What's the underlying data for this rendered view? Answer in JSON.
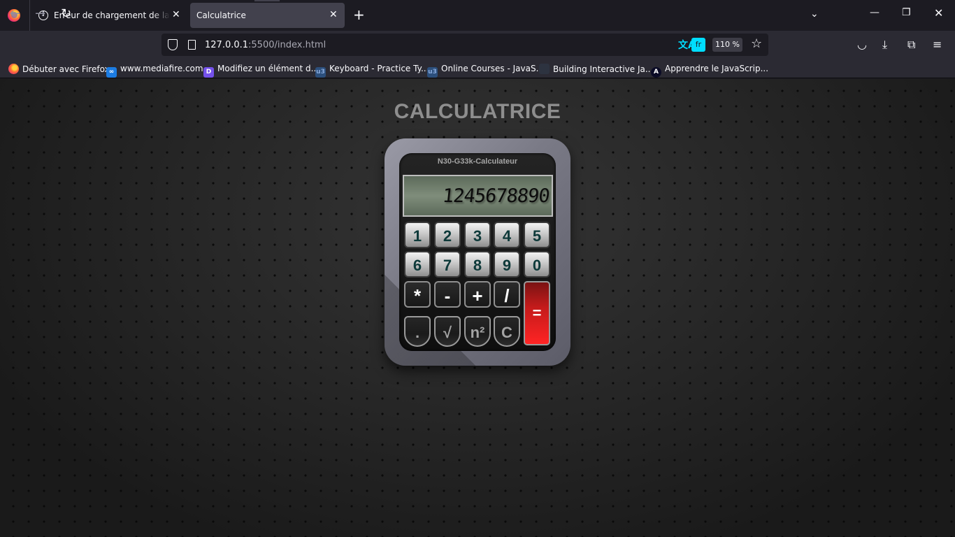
{
  "browser": {
    "tabs": [
      {
        "title": "Erreur de chargement de la page",
        "active": false
      },
      {
        "title": "Calculatrice",
        "active": true
      }
    ],
    "tab_close": "✕",
    "new_tab": "+",
    "list_all": "⌄",
    "url": {
      "host": "127.0.0.1",
      "rest": ":5500/index.html"
    },
    "translate_lang": "fr",
    "zoom": "110 %",
    "window": {
      "minimize": "—",
      "maximize": "❐",
      "close": "✕"
    },
    "nav": {
      "back": "←",
      "forward": "→",
      "reload": "↻"
    },
    "toolbar_icons": {
      "star": "☆",
      "pocket": "◡",
      "download": "⤓",
      "extensions": "⧉",
      "menu": "≡"
    },
    "bookmarks": [
      {
        "label": "Débuter avec Firefox",
        "icon_text": ""
      },
      {
        "label": "www.mediafire.com",
        "icon_text": "∞"
      },
      {
        "label": "Modifiez un élément d...",
        "icon_text": "D"
      },
      {
        "label": "Keyboard - Practice Ty...",
        "icon_text": "u3"
      },
      {
        "label": "Online Courses - JavaS...",
        "icon_text": "u3"
      },
      {
        "label": "Building Interactive Ja...",
        "icon_text": ""
      },
      {
        "label": "Apprendre le JavaScrip...",
        "icon_text": "A"
      }
    ]
  },
  "page": {
    "title": "CALCULATRICE",
    "calculator": {
      "brand": "N30-G33k-Calculateur",
      "display": "1245678890",
      "keys": {
        "row1": [
          "1",
          "2",
          "3",
          "4",
          "5"
        ],
        "row2": [
          "6",
          "7",
          "8",
          "9",
          "0"
        ],
        "ops": [
          "*",
          "-",
          "+",
          "/"
        ],
        "fns": [
          ".",
          "√",
          "n²",
          "C"
        ],
        "equals": "="
      }
    }
  },
  "colors": {
    "accent_translate": "#00ddff",
    "equals_key": "#ff2424",
    "lcd": "#7f8d7b"
  }
}
